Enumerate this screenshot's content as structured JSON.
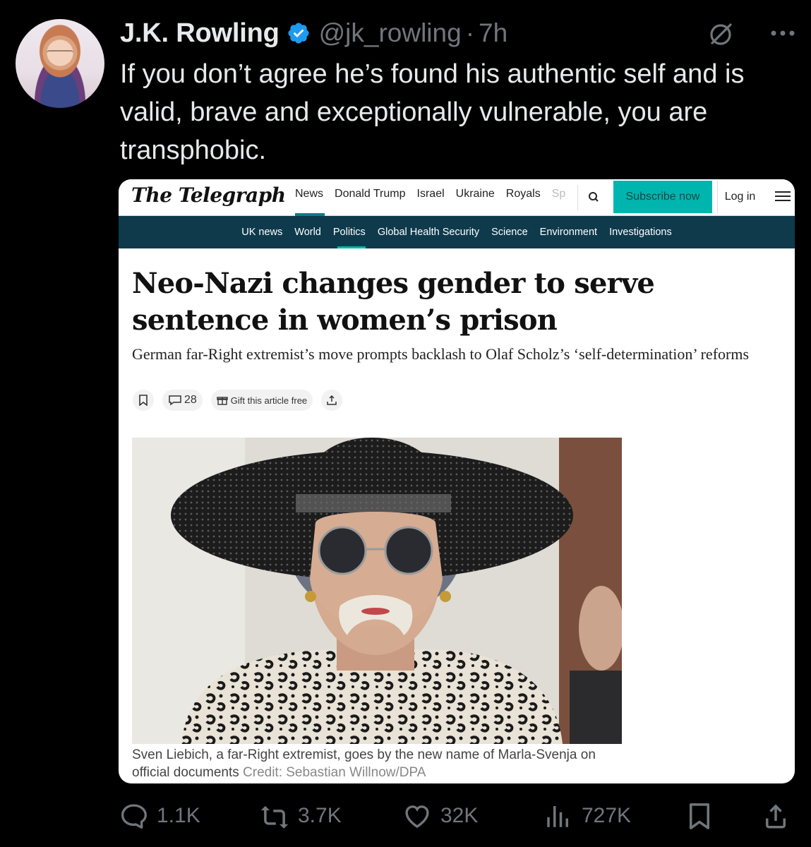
{
  "author": {
    "name": "J.K. Rowling",
    "handle": "@jk_rowling",
    "separator": "·",
    "time": "7h"
  },
  "tweet_text": "If you don’t agree he’s found his authentic self and is valid, brave and exceptionally vulnerable, you are transphobic.",
  "article": {
    "logo": "The Telegraph",
    "nav": [
      "News",
      "Donald Trump",
      "Israel",
      "Ukraine",
      "Royals",
      "Sp"
    ],
    "subscribe_label": "Subscribe now",
    "login_label": "Log in",
    "subnav": [
      "UK news",
      "World",
      "Politics",
      "Global Health Security",
      "Science",
      "Environment",
      "Investigations"
    ],
    "headline": "Neo-Nazi changes gender to serve sentence in women’s prison",
    "standfirst": "German far-Right extremist’s move prompts backlash to Olaf Scholz’s ‘self-determination’ reforms",
    "comment_count": "28",
    "gift_label": "Gift this article free",
    "caption": "Sven Liebich, a far-Right extremist, goes by the new name of Marla-Svenja on official documents",
    "credit": "Credit: Sebastian Willnow/DPA"
  },
  "stats": {
    "replies": "1.1K",
    "reposts": "3.7K",
    "likes": "32K",
    "views": "727K"
  },
  "colors": {
    "background": "#000000",
    "text": "#e7e9ea",
    "muted": "#71767b",
    "verified": "#1d9bf0",
    "telegraph_teal": "#00b5ad",
    "telegraph_navy": "#0e3a4c"
  }
}
